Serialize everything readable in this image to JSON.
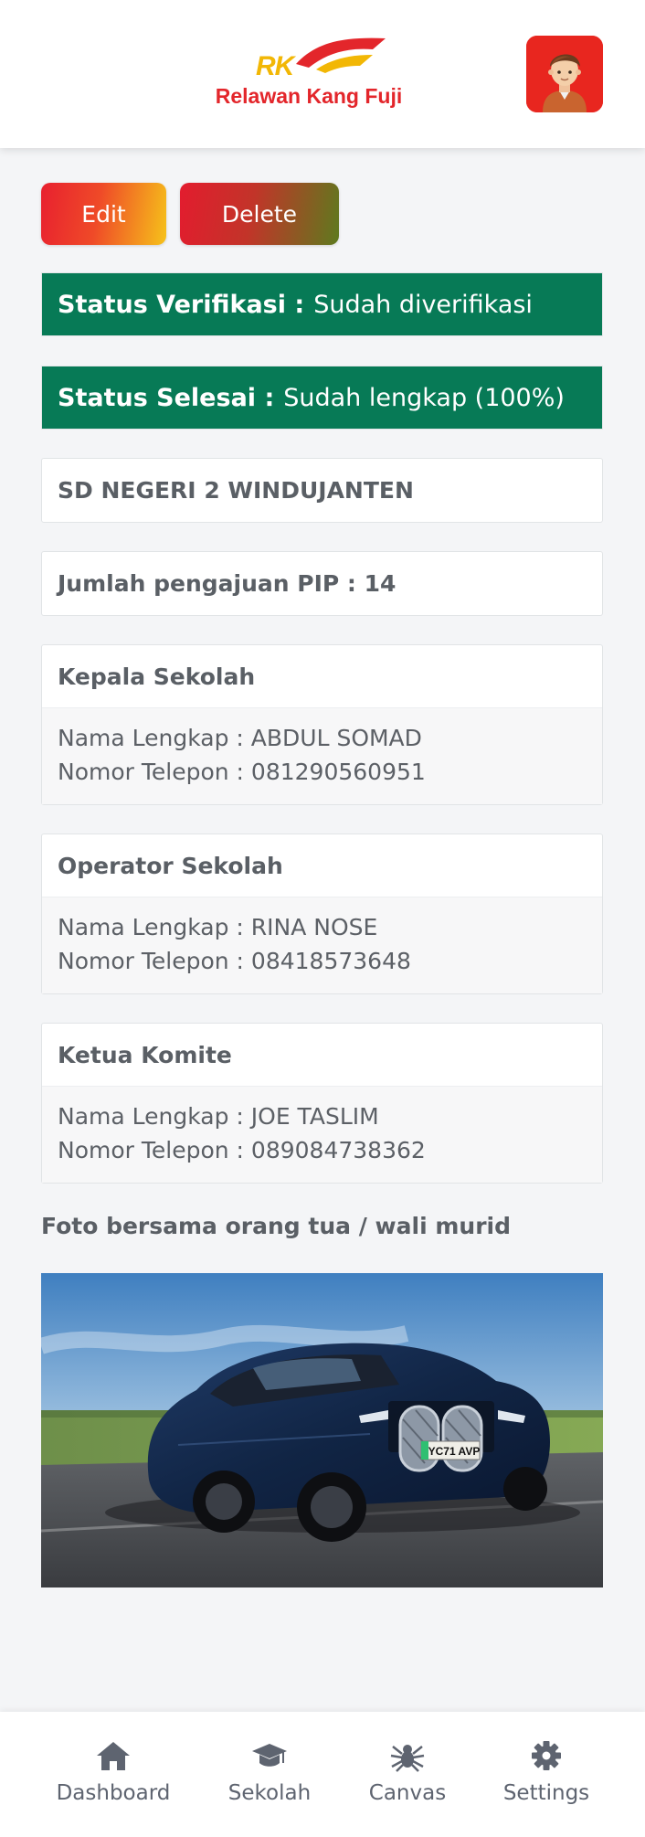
{
  "header": {
    "logo_mark": "RK",
    "logo_text": "Relawan Kang Fuji",
    "brand_red": "#e3262b",
    "brand_yellow": "#f2b705"
  },
  "actions": {
    "edit_label": "Edit",
    "delete_label": "Delete"
  },
  "status": {
    "verifikasi_label": "Status Verifikasi :",
    "verifikasi_value": "Sudah diverifikasi",
    "selesai_label": "Status Selesai :",
    "selesai_value": "Sudah lengkap (100%)",
    "color": "#077a56"
  },
  "school": {
    "name": "SD NEGERI 2 WINDUJANTEN",
    "pip": "Jumlah pengajuan PIP : 14"
  },
  "contacts": [
    {
      "title": "Kepala Sekolah",
      "nama": "Nama Lengkap : ABDUL SOMAD",
      "telepon": "Nomor Telepon : 081290560951"
    },
    {
      "title": "Operator Sekolah",
      "nama": "Nama Lengkap : RINA NOSE",
      "telepon": "Nomor Telepon : 08418573648"
    },
    {
      "title": "Ketua Komite",
      "nama": "Nama Lengkap : JOE TASLIM",
      "telepon": "Nomor Telepon : 089084738362"
    }
  ],
  "photo": {
    "label": "Foto bersama orang tua / wali murid",
    "plate": "YC71 AVP"
  },
  "bottom_nav": {
    "items": [
      {
        "label": "Dashboard",
        "icon": "home-icon"
      },
      {
        "label": "Sekolah",
        "icon": "graduation-cap-icon"
      },
      {
        "label": "Canvas",
        "icon": "spider-icon"
      },
      {
        "label": "Settings",
        "icon": "gear-icon"
      }
    ]
  }
}
